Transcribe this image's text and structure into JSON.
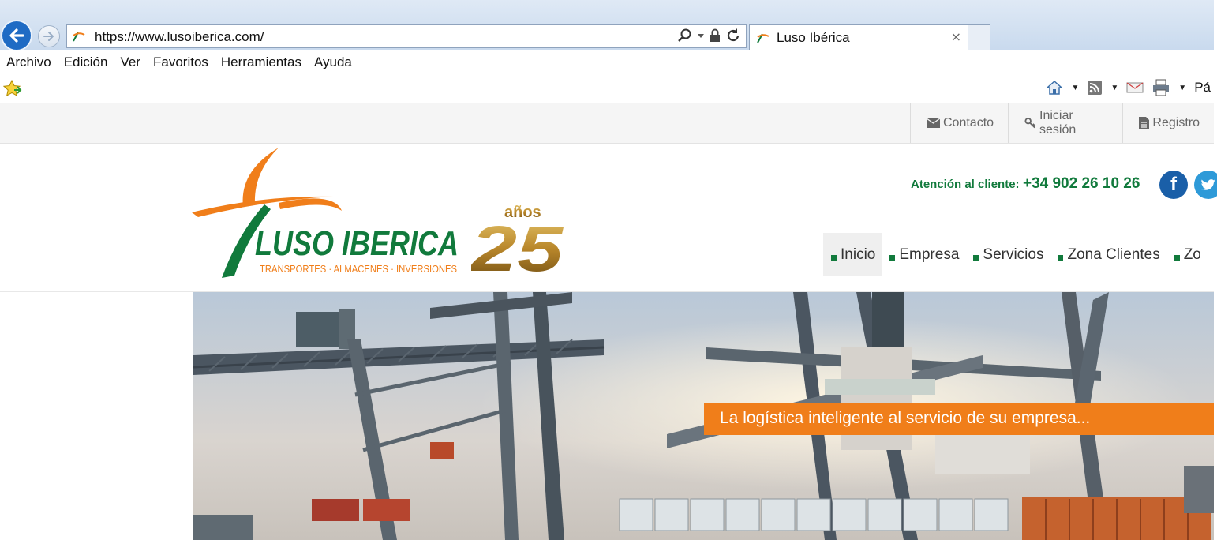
{
  "browser": {
    "url": "https://www.lusoiberica.com/",
    "tab_title": "Luso Ibérica",
    "tab_close": "×",
    "menu": [
      "Archivo",
      "Edición",
      "Ver",
      "Favoritos",
      "Herramientas",
      "Ayuda"
    ],
    "page_menu_partial": "Pá"
  },
  "site": {
    "topbar": {
      "contact": "Contacto",
      "login": "Iniciar sesión",
      "register": "Registro"
    },
    "logo": {
      "brand": "LUSO IBERICA",
      "tagline": "TRANSPORTES · ALMACENES · INVERSIONES",
      "anniv_number": "25",
      "anniv_word": "años"
    },
    "customer_service": {
      "label": "Atención al cliente:",
      "phone": "+34 902 26 10 26"
    },
    "social": {
      "facebook": "f"
    },
    "nav": [
      {
        "label": "Inicio",
        "active": true
      },
      {
        "label": "Empresa"
      },
      {
        "label": "Servicios"
      },
      {
        "label": "Zona Clientes"
      },
      {
        "label": "Zo"
      }
    ],
    "hero": {
      "caption": "La logística inteligente al servicio de su empresa..."
    }
  },
  "colors": {
    "brand_green": "#117a3c",
    "brand_orange": "#f07e1a",
    "ie_blue": "#1f6bc4"
  }
}
